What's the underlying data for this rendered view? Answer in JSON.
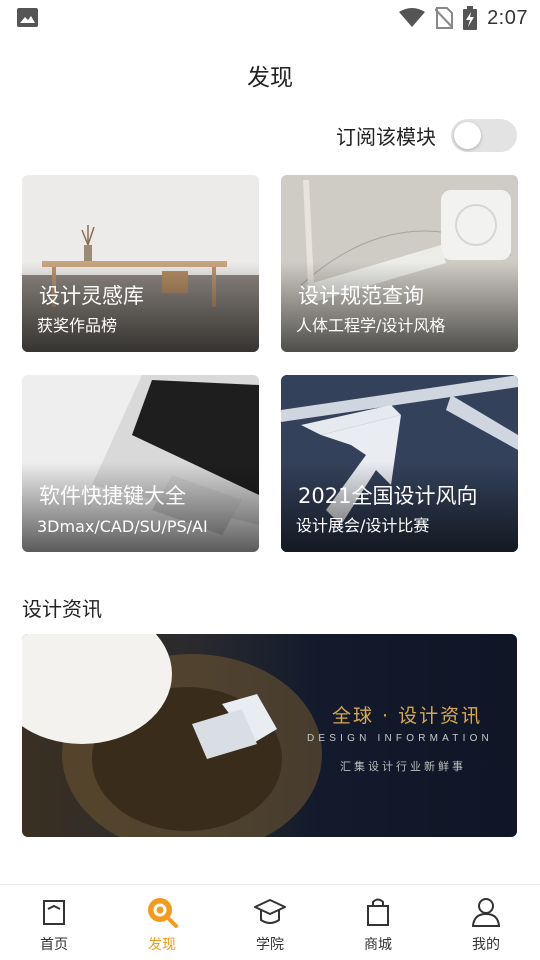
{
  "status_bar": {
    "time": "2:07",
    "icons": [
      "image-icon",
      "wifi-icon",
      "no-sim-icon",
      "battery-charging-icon"
    ]
  },
  "header": {
    "title": "发现"
  },
  "subscribe": {
    "label": "订阅该模块",
    "enabled": false
  },
  "cards": [
    {
      "title": "设计灵感库",
      "subtitle": "获奖作品榜"
    },
    {
      "title": "设计规范查询",
      "subtitle": "人体工程学/设计风格"
    },
    {
      "title": "软件快捷键大全",
      "subtitle": "3Dmax/CAD/SU/PS/AI"
    },
    {
      "title": "2021全国设计风向",
      "subtitle": "设计展会/设计比赛"
    }
  ],
  "news": {
    "section_title": "设计资讯",
    "banner": {
      "headline": "全球 · 设计资讯",
      "subtitle_en": "DESIGN INFORMATION",
      "subtitle_cn": "汇集设计行业新鲜事"
    }
  },
  "bottom_nav": [
    {
      "label": "首页",
      "icon": "home-icon",
      "active": false
    },
    {
      "label": "发现",
      "icon": "discover-icon",
      "active": true
    },
    {
      "label": "学院",
      "icon": "academy-icon",
      "active": false
    },
    {
      "label": "商城",
      "icon": "shop-icon",
      "active": false
    },
    {
      "label": "我的",
      "icon": "profile-icon",
      "active": false
    }
  ],
  "colors": {
    "accent": "#f29c1f",
    "toggle_off": "#e3e3e3",
    "banner_gold": "#d9a84e"
  }
}
